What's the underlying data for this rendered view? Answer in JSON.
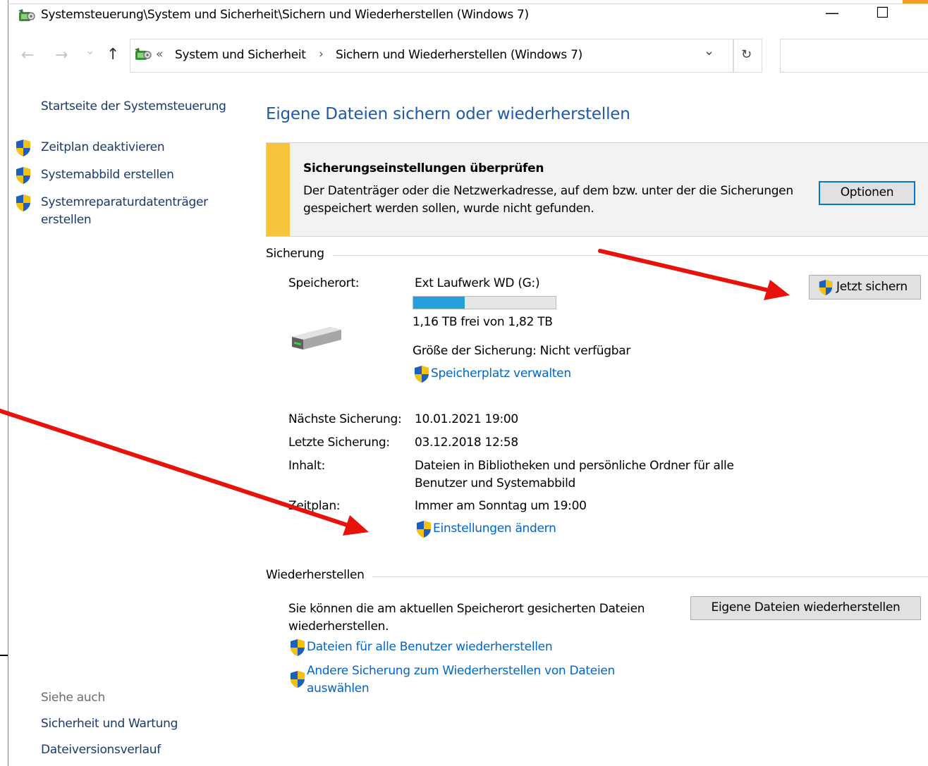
{
  "window": {
    "title": "Systemsteuerung\\System und Sicherheit\\Sichern und Wiederherstellen (Windows 7)",
    "minimize_glyph": "—",
    "maximize_glyph": "☐"
  },
  "nav": {
    "back_glyph": "←",
    "forward_glyph": "→",
    "recent_glyph": "⌄",
    "up_glyph": "↑",
    "overflow_glyph": "«",
    "dropdown_glyph": "⌄",
    "refresh_glyph": "↻",
    "crumb_separator": "›",
    "breadcrumbs": [
      "System und Sicherheit",
      "Sichern und Wiederherstellen (Windows 7)"
    ]
  },
  "sidebar": {
    "home_link": "Startseite der Systemsteuerung",
    "items": [
      {
        "label": "Zeitplan deaktivieren",
        "icon": "uac-shield-icon"
      },
      {
        "label": "Systemabbild erstellen",
        "icon": "uac-shield-icon"
      },
      {
        "label": "Systemreparaturdatenträger",
        "label_line2": "erstellen",
        "icon": "uac-shield-icon"
      }
    ],
    "see_also_heading": "Siehe auch",
    "see_also": [
      "Sicherheit und Wartung",
      "Dateiversionsverlauf"
    ]
  },
  "main": {
    "title": "Eigene Dateien sichern oder wiederherstellen",
    "notice": {
      "heading": "Sicherungseinstellungen überprüfen",
      "line1": "Der Datenträger oder die Netzwerkadresse, auf dem bzw. unter der die Sicherungen",
      "line2": "gespeichert werden sollen, wurde nicht gefunden.",
      "button": "Optionen",
      "stripe_color": "#f7c33a"
    },
    "backup": {
      "group_label": "Sicherung",
      "location_label": "Speicherort:",
      "location_value": "Ext Laufwerk WD (G:)",
      "used_fraction": 0.36,
      "free_text": "1,16 TB frei von 1,82 TB",
      "size_text": "Größe der Sicherung: Nicht verfügbar",
      "manage_link": "Speicherplatz verwalten",
      "backup_now_button": "Jetzt sichern",
      "next_label": "Nächste Sicherung:",
      "next_value": "10.01.2021 19:00",
      "last_label": "Letzte Sicherung:",
      "last_value": "03.12.2018 12:58",
      "content_label": "Inhalt:",
      "content_line1": "Dateien in Bibliotheken und persönliche Ordner für alle",
      "content_line2": "Benutzer und Systemabbild",
      "schedule_label": "Zeitplan:",
      "schedule_value": "Immer am Sonntag um 19:00",
      "change_settings_link": "Einstellungen ändern"
    },
    "restore": {
      "group_label": "Wiederherstellen",
      "text_line1": "Sie können die am aktuellen Speicherort gesicherten Dateien",
      "text_line2": "wiederherstellen.",
      "restore_button": "Eigene Dateien wiederherstellen",
      "all_users_link": "Dateien für alle Benutzer wiederherstellen",
      "other_backup_link_line1": "Andere Sicherung zum Wiederherstellen von Dateien",
      "other_backup_link_line2": "auswählen"
    }
  },
  "colors": {
    "link": "#0066cc",
    "title_blue": "#1e5aa8",
    "annotation_arrow": "#e8120c",
    "progress_fill": "#26a0da",
    "primary_button_border": "#0078d7"
  }
}
